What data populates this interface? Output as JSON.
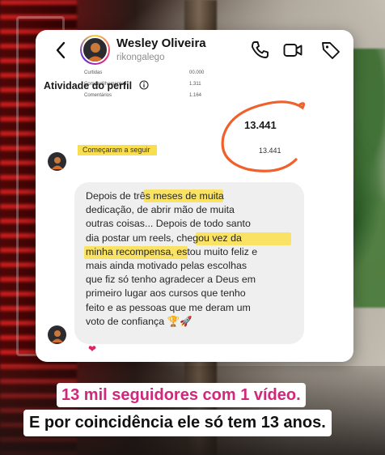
{
  "header": {
    "name": "Wesley Oliveira",
    "handle": "rikongalego"
  },
  "shared_post": {
    "faded_rows": [
      {
        "label": "Curtidas",
        "value": "00.000"
      },
      {
        "label": "Compartilhamentos",
        "value": "1.311"
      },
      {
        "label": "Comentários",
        "value": "1.164"
      }
    ],
    "activity_title": "Atividade do perfil",
    "activity_total": "13.441",
    "follow_label": "Começaram a seguir",
    "follow_value": "13.441"
  },
  "message": {
    "text": "Depois de três meses de muita\ndedicação, de abrir mão de muita\noutras coisas... Depois de todo santo\ndia postar um reels, chegou vez  da\nminha recompensa, estou muito feliz e\nmais ainda motivado pelas escolhas\nque fiz só tenho agradecer a Deus em\nprimeiro lugar aos cursos que tenho\nfeito e  as pessoas que me deram um\nvoto de confiança 🏆🚀",
    "reaction": "❤"
  },
  "captions": {
    "line1": "13 mil seguidores com 1 vídeo.",
    "line2": "E por coincidência ele só tem 13 anos."
  },
  "colors": {
    "highlight": "#fbe04b",
    "annotation_circle": "#f0602a",
    "caption_pink": "#d0287a"
  }
}
